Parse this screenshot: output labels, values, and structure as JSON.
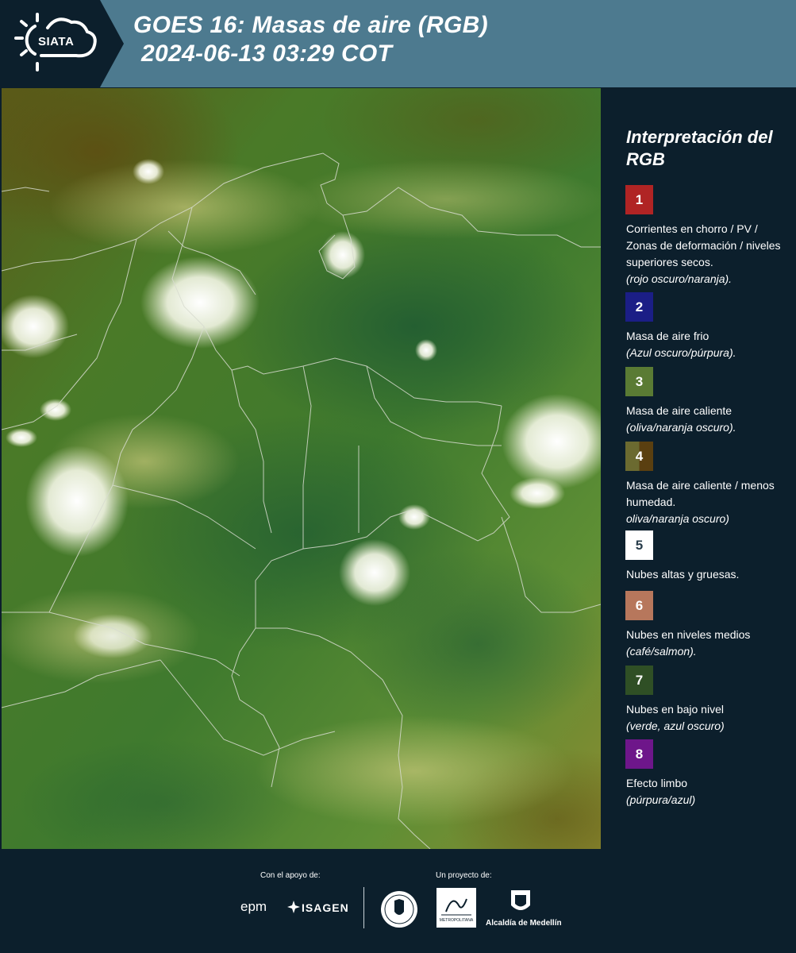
{
  "header": {
    "logo_text": "SIATA",
    "title_line1": "GOES 16: Masas de aire (RGB)",
    "title_line2": "2024-06-13 03:29 COT",
    "background_color": "#4d7a8f"
  },
  "legend": {
    "title": "Interpretación del RGB",
    "items": [
      {
        "number": "1",
        "color": "#b02424",
        "text": "Corrientes en chorro / PV / Zonas de deformación / niveles superiores secos.",
        "note": "(rojo oscuro/naranja)."
      },
      {
        "number": "2",
        "color": "#1b1e86",
        "text": "Masa de aire frio",
        "note": "(Azul oscuro/púrpura)."
      },
      {
        "number": "3",
        "color": "#5a7b34",
        "text": "Masa de aire caliente",
        "note": "(oliva/naranja oscuro)."
      },
      {
        "number": "4",
        "color": "#6b6127",
        "text": "Masa de aire caliente / menos humedad.",
        "note": "oliva/naranja oscuro)"
      },
      {
        "number": "5",
        "color": "#ffffff",
        "text": "Nubes altas y gruesas.",
        "note": ""
      },
      {
        "number": "6",
        "color": "#b7775c",
        "text": "Nubes en niveles medios",
        "note": "(café/salmon)."
      },
      {
        "number": "7",
        "color": "#2f4f25",
        "text": "Nubes en bajo nivel",
        "note": "(verde, azul oscuro)"
      },
      {
        "number": "8",
        "color": "#6e168a",
        "text": "Efecto limbo",
        "note": "(púrpura/azul)"
      }
    ]
  },
  "footer": {
    "support_label": "Con el apoyo de:",
    "project_label": "Un proyecto de:",
    "support_logos": [
      "epm",
      "ISAGEN"
    ],
    "project_logos": [
      "Área Metropolitana",
      "Alcaldía de Medellín"
    ],
    "epm_text": "epm",
    "isagen_text": "ISAGEN",
    "amva_text": "METROPOLITANA",
    "alcaldia_text": "Alcaldía de Medellín"
  }
}
